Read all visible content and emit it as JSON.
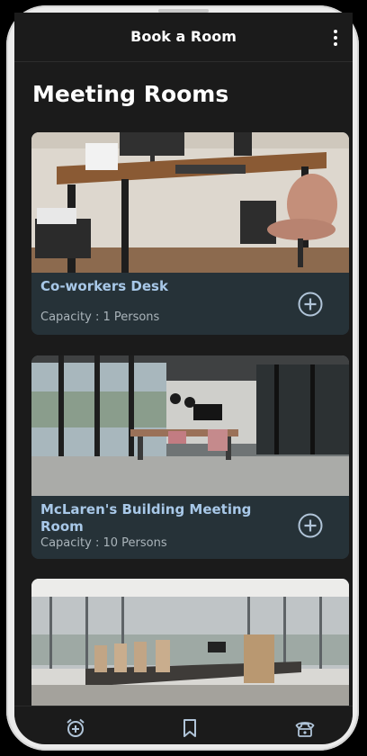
{
  "app": {
    "title": "Book a Room",
    "menu_icon": "more-vertical-icon"
  },
  "page": {
    "title": "Meeting Rooms"
  },
  "rooms": [
    {
      "name": "Co-workers Desk",
      "capacity": "Capacity : 1 Persons",
      "image": "desk-with-chair-photo",
      "action_icon": "add-circle-icon"
    },
    {
      "name": "McLaren's Building Meeting Room",
      "capacity": "Capacity : 10 Persons",
      "image": "modern-meeting-room-photo",
      "action_icon": "add-circle-icon"
    },
    {
      "name": "",
      "capacity": "",
      "image": "conference-room-photo",
      "action_icon": ""
    }
  ],
  "bottom_nav": [
    {
      "icon": "alarm-add-icon"
    },
    {
      "icon": "bookmark-icon"
    },
    {
      "icon": "phone-icon"
    }
  ],
  "colors": {
    "background": "#1b1b1b",
    "card_footer": "#263238",
    "room_name": "#a8c8e8",
    "capacity_text": "#aab4ba",
    "icon": "#b0c4d8"
  }
}
